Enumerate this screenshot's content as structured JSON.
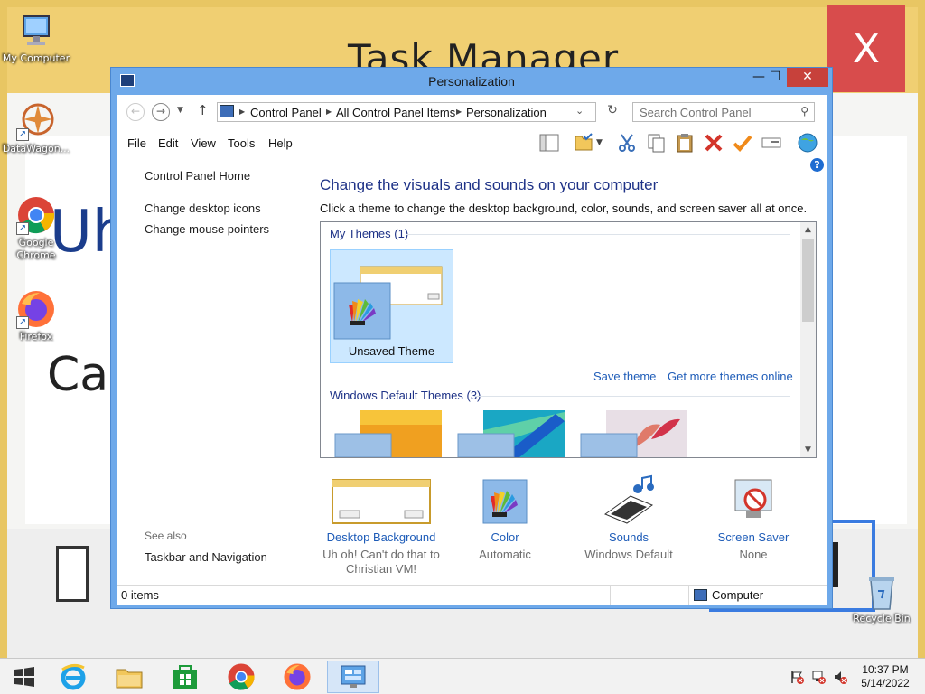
{
  "wallpaper": {
    "title": "Task Manager",
    "close": "X",
    "big_text_1": "Uh",
    "big_text_2": "Can'"
  },
  "desktop_icons": [
    {
      "label": "My Computer"
    },
    {
      "label": "DataWagon..."
    },
    {
      "label": "Google Chrome"
    },
    {
      "label": "Firefox"
    },
    {
      "label": "Recycle Bin"
    }
  ],
  "window": {
    "title": "Personalization",
    "minimize": "—",
    "maximize": "☐",
    "close": "✕"
  },
  "address": {
    "crumbs": [
      "Control Panel",
      "All Control Panel Items",
      "Personalization"
    ],
    "search_placeholder": "Search Control Panel"
  },
  "menu": [
    "File",
    "Edit",
    "View",
    "Tools",
    "Help"
  ],
  "left_pane": {
    "home": "Control Panel Home",
    "links": [
      "Change desktop icons",
      "Change mouse pointers"
    ],
    "see_also_label": "See also",
    "see_also_links": [
      "Taskbar and Navigation"
    ]
  },
  "main": {
    "title": "Change the visuals and sounds on your computer",
    "subtitle": "Click a theme to change the desktop background, color, sounds, and screen saver all at once.",
    "my_themes_label": "My Themes (1)",
    "selected_theme": "Unsaved Theme",
    "save_theme": "Save theme",
    "get_more": "Get more themes online",
    "default_themes_label": "Windows Default Themes (3)"
  },
  "settings": [
    {
      "label": "Desktop Background",
      "value": "Uh oh! Can't do that to Christian VM!"
    },
    {
      "label": "Color",
      "value": "Automatic"
    },
    {
      "label": "Sounds",
      "value": "Windows Default"
    },
    {
      "label": "Screen Saver",
      "value": "None"
    }
  ],
  "status": {
    "items": "0 items",
    "zone": "Computer"
  },
  "taskbar": {
    "time": "10:37 PM",
    "date": "5/14/2022"
  },
  "colors": {
    "accent_window": "#6ea9ea",
    "link": "#1e5cb8",
    "heading": "#1e3287",
    "close_red": "#c7413b",
    "selection": "#cce8ff"
  }
}
